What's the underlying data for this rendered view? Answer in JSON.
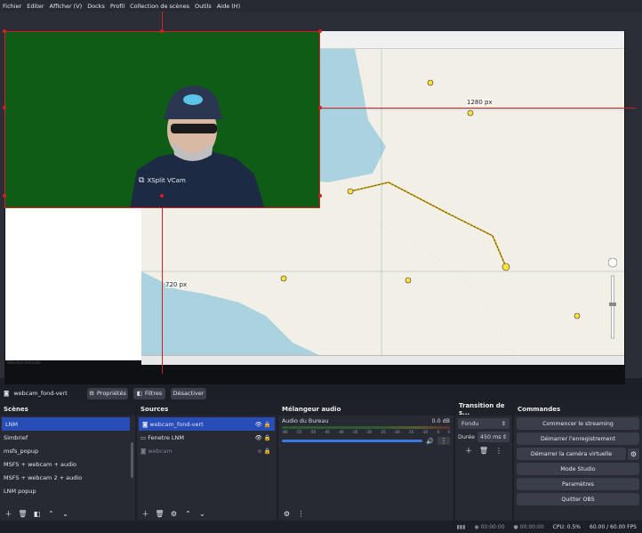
{
  "menu": [
    "Fichier",
    "Editer",
    "Afficher (V)",
    "Docks",
    "Profil",
    "Collection de scènes",
    "Outils",
    "Aide (H)"
  ],
  "preview": {
    "label_top": "1280 px",
    "label_left": "720 px",
    "vcam_label": "XSplit VCam",
    "status_text": "Sélection terminée"
  },
  "source_toolbar": {
    "source_name": "webcam_fond-vert",
    "properties": "Propriétés",
    "filters": "Filtres",
    "deactivate": "Désactiver"
  },
  "scenes": {
    "title": "Scènes",
    "items": [
      "LNM",
      "Simbrief",
      "msfs_popup",
      "MSFS + webcam + audio",
      "MSFS + webcam 2 + audio",
      "LNM popup"
    ],
    "selected_index": 0
  },
  "sources": {
    "title": "Sources",
    "items": [
      {
        "name": "webcam_fond-vert",
        "type": "camera",
        "visible": true
      },
      {
        "name": "Fenetre LNM",
        "type": "window",
        "visible": true
      },
      {
        "name": "webcam",
        "type": "camera",
        "visible": false
      }
    ],
    "selected_index": 0
  },
  "mixer": {
    "title": "Mélangeur audio",
    "channel": "Audio du Bureau",
    "db": "0.0 dB",
    "ticks": [
      "-60",
      "-55",
      "-50",
      "-45",
      "-40",
      "-35",
      "-30",
      "-25",
      "-20",
      "-15",
      "-10",
      "-5",
      "0"
    ],
    "volume": 1.0
  },
  "transition": {
    "title": "Transition de s...",
    "type": "Fondu",
    "duration_label": "Durée",
    "duration_value": "450 ms"
  },
  "commands": {
    "title": "Commandes",
    "start_streaming": "Commencer le streaming",
    "start_recording": "Démarrer l'enregistrement",
    "start_vcam": "Démarrer la caméra virtuelle",
    "studio_mode": "Mode Studio",
    "settings": "Paramètres",
    "quit": "Quitter OBS"
  },
  "status": {
    "stream_time": "00:00:00",
    "rec_time": "00:00:00",
    "cpu": "CPU: 0.5%",
    "fps": "60.00 / 60.00 FPS"
  },
  "colors": {
    "accent": "#284cb8",
    "guide": "#d42020",
    "green_screen": "#0f5c16"
  }
}
